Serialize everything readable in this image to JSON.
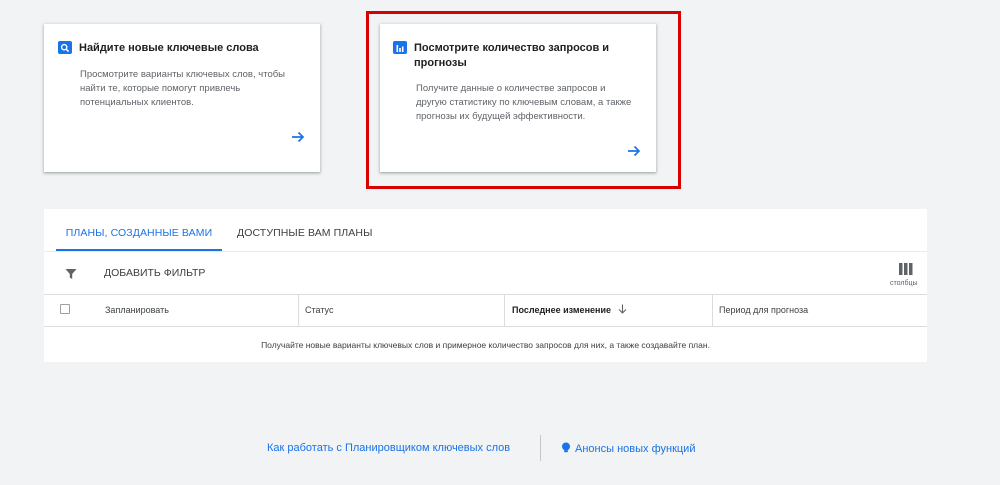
{
  "cards": {
    "find_keywords": {
      "title": "Найдите новые ключевые слова",
      "desc_lines": [
        "Просмотрите варианты ключевых слов, чтобы",
        "найти те, которые помогут привлечь",
        "потенциальных клиентов."
      ],
      "icon": "search-icon",
      "arrow_icon": "arrow-right-icon"
    },
    "forecast": {
      "title_lines": [
        "Посмотрите количество запросов и",
        "прогнозы"
      ],
      "desc_lines": [
        "Получите данные о количестве запросов и",
        "другую статистику по ключевым словам, а также",
        "прогнозы их будущей эффективности."
      ],
      "icon": "bar-chart-icon",
      "arrow_icon": "arrow-right-icon"
    }
  },
  "plans": {
    "tabs": [
      {
        "label": "ПЛАНЫ, СОЗДАННЫЕ ВАМИ",
        "active": true
      },
      {
        "label": "ДОСТУПНЫЕ ВАМ ПЛАНЫ",
        "active": false
      }
    ],
    "filter_label": "ДОБАВИТЬ ФИЛЬТР",
    "columns_label": "столбцы",
    "headers": [
      "Запланировать",
      "Статус",
      "Последнее изменение",
      "Период для прогноза"
    ],
    "sort_column": "Последнее изменение",
    "empty_message": "Получайте новые варианты ключевых слов и примерное количество запросов для них, а также создавайте план."
  },
  "footer": {
    "how_to_link": "Как работать с Планировщиком ключевых слов",
    "announcements_link": "Анонсы новых функций"
  },
  "colors": {
    "accent": "#1a73e8",
    "highlight": "#d90000",
    "background": "#f1f3f4"
  }
}
